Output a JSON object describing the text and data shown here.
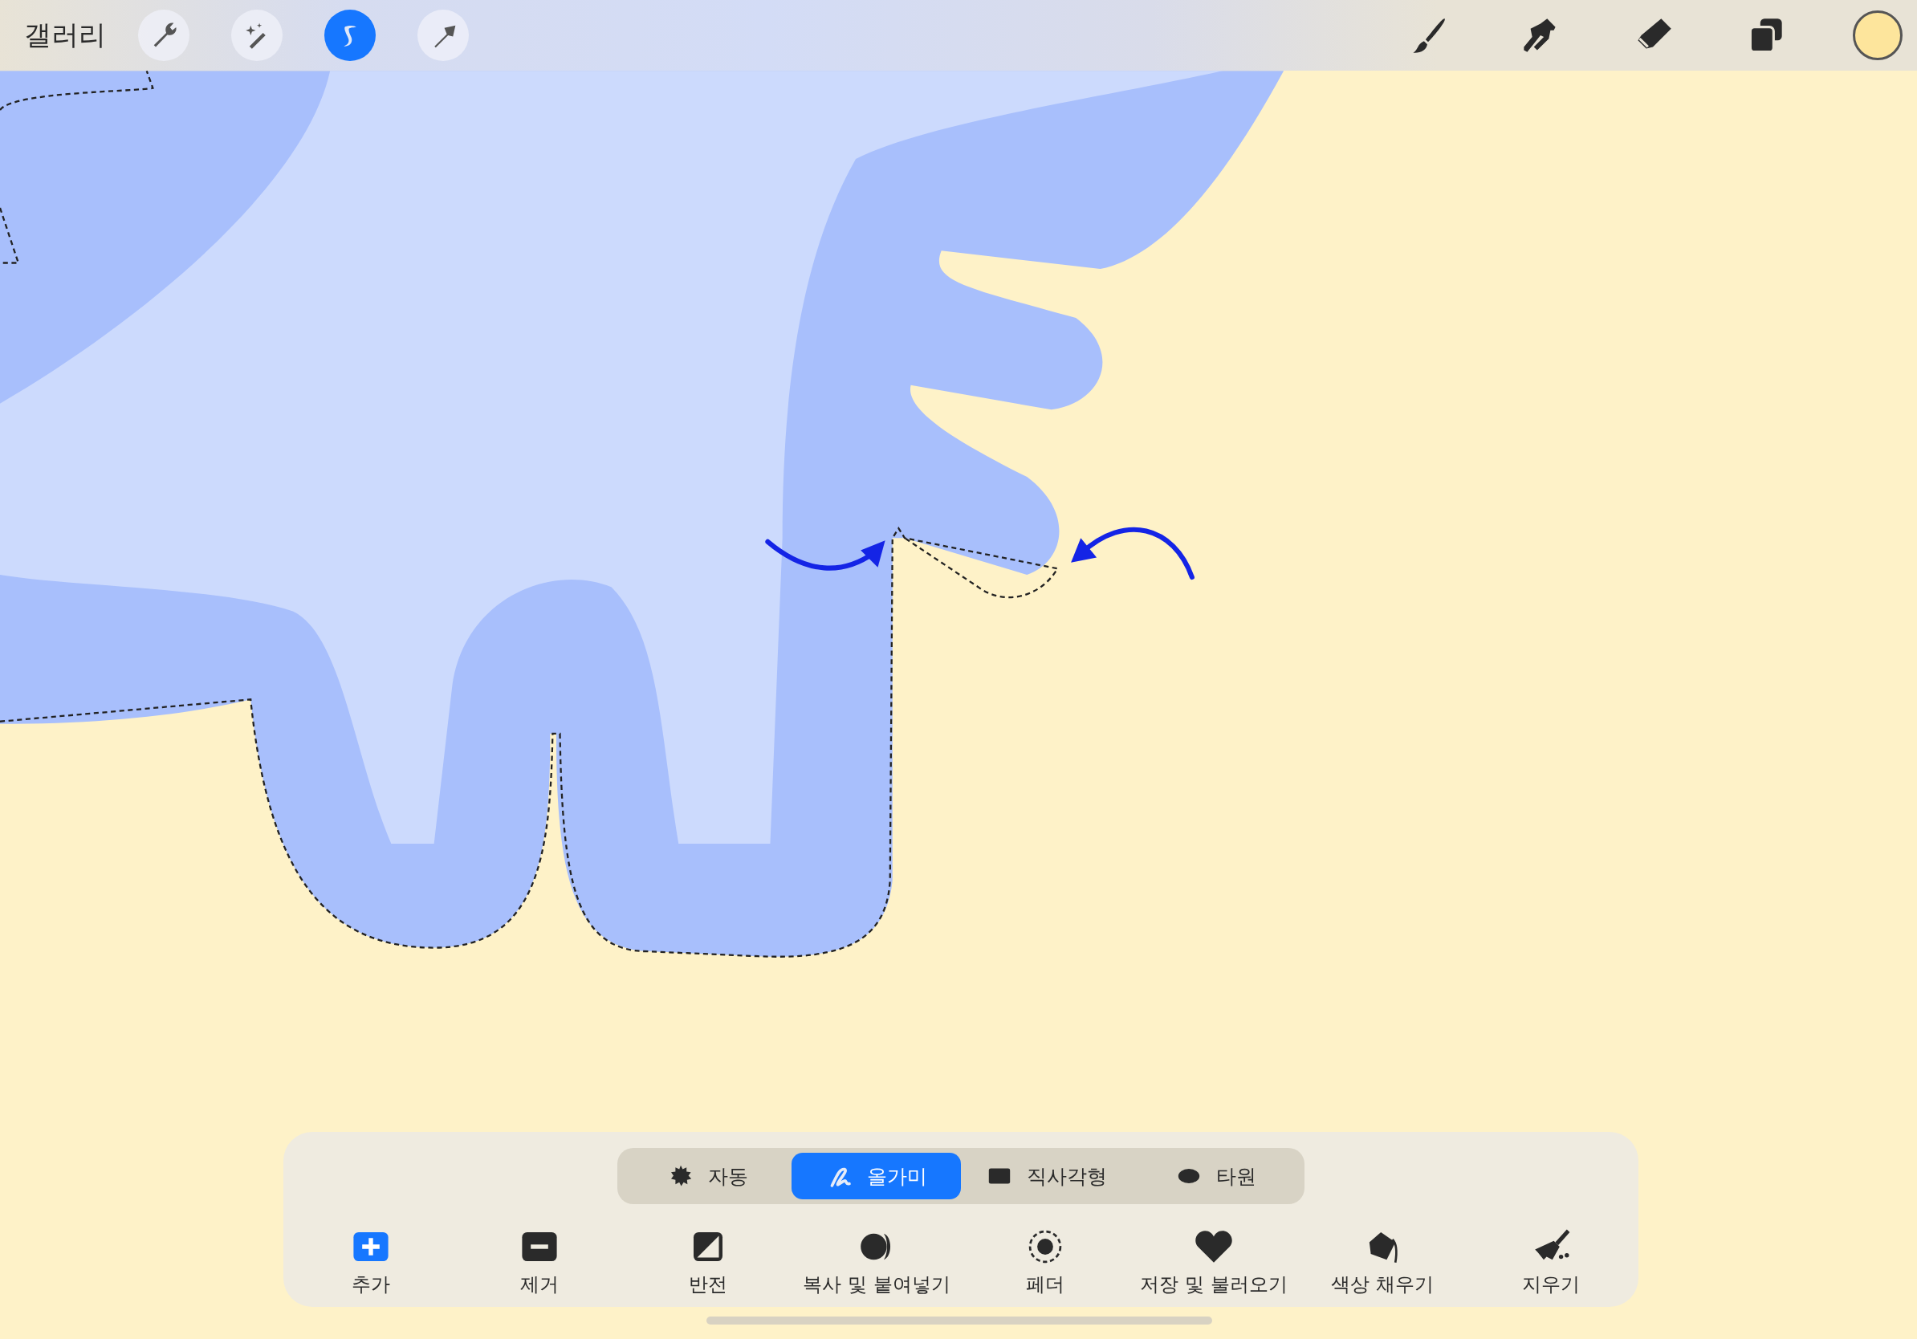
{
  "toolbar": {
    "gallery": "갤러리",
    "left_tools": [
      {
        "kind": "wrench",
        "selected": false
      },
      {
        "kind": "wand",
        "selected": false
      },
      {
        "kind": "selection",
        "selected": true
      },
      {
        "kind": "transform",
        "selected": false
      }
    ],
    "right_tools": [
      {
        "kind": "brush"
      },
      {
        "kind": "smudge"
      },
      {
        "kind": "eraser"
      },
      {
        "kind": "layers"
      }
    ],
    "color": "#fde59c"
  },
  "selection_panel": {
    "modes": [
      {
        "kind": "auto",
        "label": "자동",
        "selected": false
      },
      {
        "kind": "lasso",
        "label": "올가미",
        "selected": true
      },
      {
        "kind": "rectangle",
        "label": "직사각형",
        "selected": false
      },
      {
        "kind": "ellipse",
        "label": "타원",
        "selected": false
      }
    ],
    "actions": [
      {
        "kind": "add",
        "label": "추가",
        "selected": true
      },
      {
        "kind": "remove",
        "label": "제거",
        "selected": false
      },
      {
        "kind": "invert",
        "label": "반전",
        "selected": false
      },
      {
        "kind": "copy",
        "label": "복사 및 붙여넣기",
        "selected": false
      },
      {
        "kind": "feather",
        "label": "페더",
        "selected": false
      },
      {
        "kind": "save",
        "label": "저장 및 불러오기",
        "selected": false
      },
      {
        "kind": "fill",
        "label": "색상 채우기",
        "selected": false
      },
      {
        "kind": "clear",
        "label": "지우기",
        "selected": false
      }
    ]
  }
}
